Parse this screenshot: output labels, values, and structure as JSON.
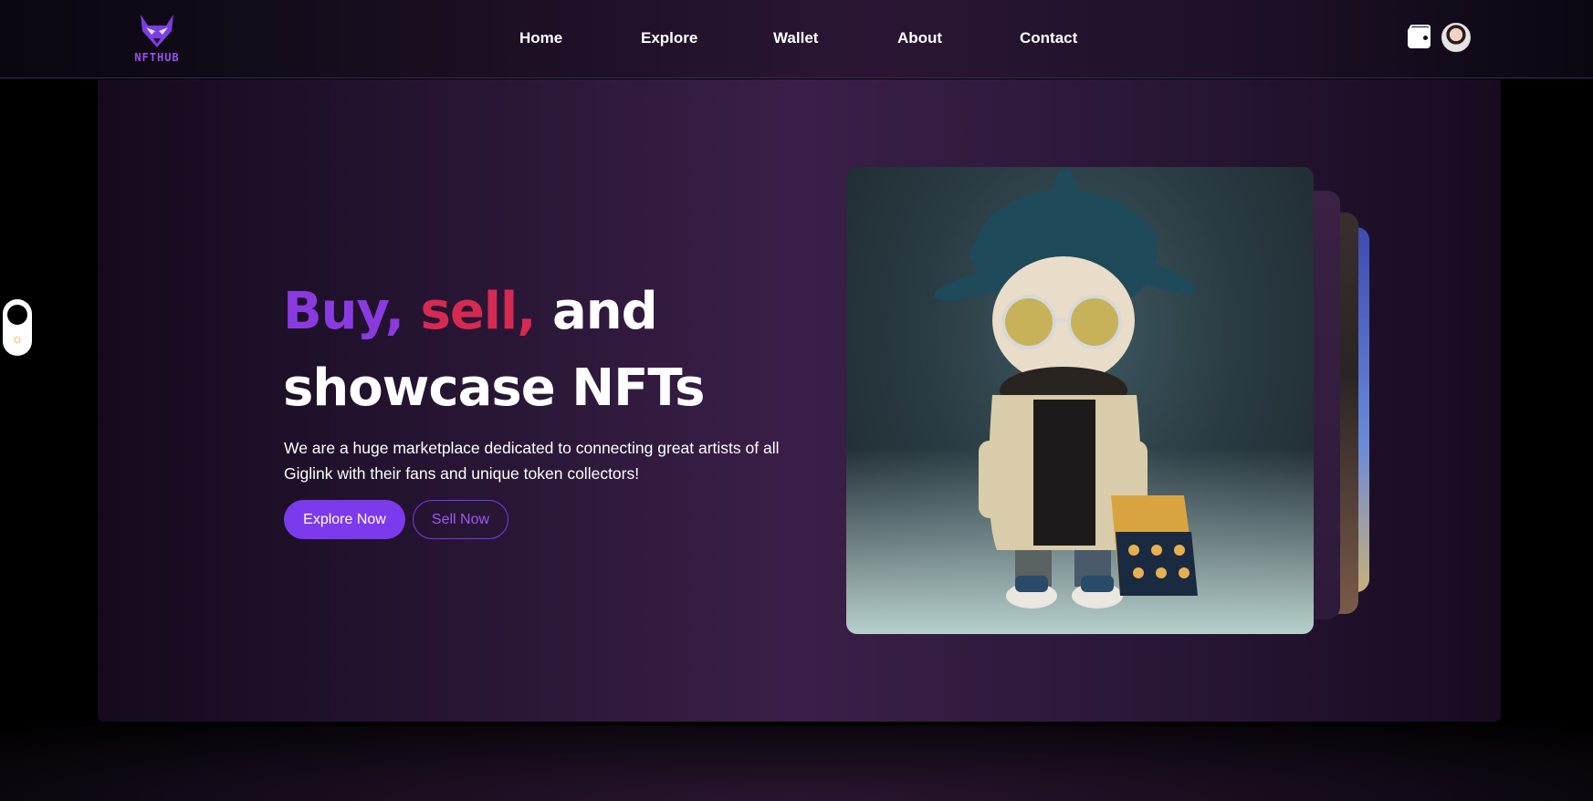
{
  "brand": {
    "logo_text": "NFTHUB"
  },
  "nav": {
    "items": [
      {
        "label": "Home"
      },
      {
        "label": "Explore"
      },
      {
        "label": "Wallet"
      },
      {
        "label": "About"
      },
      {
        "label": "Contact"
      }
    ]
  },
  "header_actions": {
    "wallet_icon": "wallet-icon",
    "avatar_icon": "user-avatar"
  },
  "theme_toggle": {
    "state": "dark",
    "icons": [
      "moon-knob",
      "sun-icon"
    ]
  },
  "hero": {
    "headline": {
      "buy": "Buy,",
      "sell": "sell,",
      "and": "and",
      "line2": "showcase NFTs"
    },
    "subtitle": "We are a huge marketplace dedicated to connecting great artists of all Giglink with their fans and unique token collectors!",
    "primary_button": "Explore Now",
    "secondary_button": "Sell Now"
  },
  "colors": {
    "accent": "#7c3aed",
    "buy": "#8a3be0",
    "sell": "#d62a52",
    "background": "#000000"
  }
}
